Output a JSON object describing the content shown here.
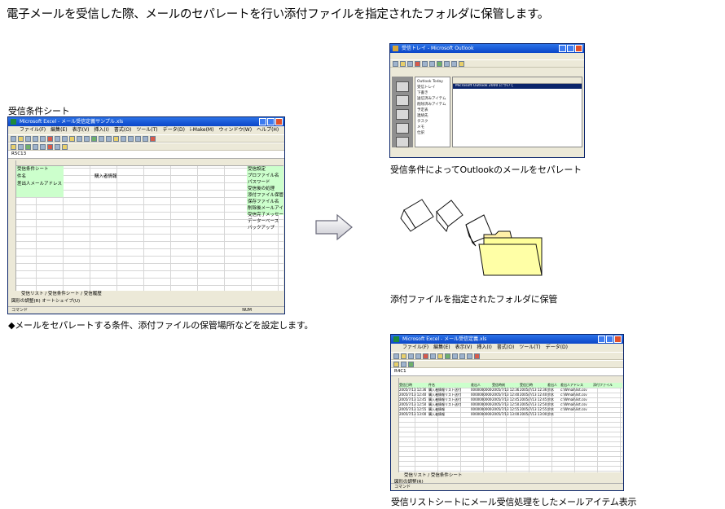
{
  "headline": "電子メールを受信した際、メールのセパレートを行い添付ファイルを指定されたフォルダに保管します。",
  "left_panel": {
    "label": "受信条件シート",
    "window_title": "Microsoft Excel - メール受信定義サンプル.xls",
    "menu": [
      "ファイル(F)",
      "編集(E)",
      "表示(V)",
      "挿入(I)",
      "書式(O)",
      "ツール(T)",
      "データ(D)",
      "i-Make(M)",
      "ウィンドウ(W)",
      "ヘルプ(H)"
    ],
    "name_box": "R5C13",
    "sheet_tabs": [
      "受信リスト",
      "受信条件シート",
      "受信履歴"
    ],
    "status": "コマンド",
    "status_right": "NUM",
    "drawing_toolbar": "図形の調整(R)",
    "autoshape": "オートシェイプ(U)",
    "cells": {
      "header": "受信条件シート",
      "r1": "件名",
      "r2": "差出人メールアドレス",
      "mid": "購入者情報",
      "side": [
        "受信設定",
        "プロファイル名",
        "パスワード",
        "受信後の処理",
        "添付ファイル保管先",
        "保存ファイル名",
        "削除後メールアイテム",
        "受信完了メッセージ",
        "データーベース",
        "バックアップ"
      ]
    },
    "caption": "◆メールをセパレートする条件、添付ファイルの保管場所などを設定します。"
  },
  "outlook_panel": {
    "window_title": "受信トレイ - Microsoft Outlook",
    "tree": [
      "Outlook Today",
      "受信トレイ",
      "下書き",
      "送信済みアイテム",
      "削除済みアイテム",
      "予定表",
      "連絡先",
      "タスク",
      "メモ",
      "仕訳"
    ],
    "selected_row": "Microsoft Outlook 2000 について",
    "caption": "受信条件によってOutlookのメールをセパレート"
  },
  "folder_panel": {
    "caption": "添付ファイルを指定されたフォルダに保管"
  },
  "list_panel": {
    "window_title": "Microsoft Excel - メール受信定義.xls",
    "name_box": "R4C1",
    "columns": [
      "受信日時",
      "件名",
      "差出人",
      "受信時刻",
      "受信日時",
      "差出人",
      "差出人アドレス",
      "添付ファイル"
    ],
    "rows": [
      [
        "2005/7/13 12:36",
        "購入者情報リスト送付",
        "00000000000",
        "2005/7/13 12:36",
        "2005/7/13 12:36",
        "鈴木",
        "c:\\Wmail\\list.csv"
      ],
      [
        "2005/7/13 12:40",
        "購入者情報リスト送付",
        "00000000000",
        "2005/7/13 12:40",
        "2005/7/13 12:40",
        "鈴木",
        "c:\\Wmail\\list.csv"
      ],
      [
        "2005/7/13 12:45",
        "購入者情報リスト送付",
        "00000000000",
        "2005/7/13 12:45",
        "2005/7/13 12:45",
        "鈴木",
        "c:\\Wmail\\list.csv"
      ],
      [
        "2005/7/13 12:50",
        "購入者情報リスト送付",
        "00000000000",
        "2005/7/13 12:50",
        "2005/7/13 12:50",
        "鈴木",
        "c:\\Wmail\\list.csv"
      ],
      [
        "2005/7/13 12:55",
        "購入者情報",
        "00000000000",
        "2005/7/13 12:55",
        "2005/7/13 12:55",
        "鈴木",
        "c:\\Wmail\\list.csv"
      ],
      [
        "2005/7/13 13:00",
        "購入者情報",
        "00000000000",
        "2005/7/13 13:00",
        "2005/7/13 13:00",
        "鈴木",
        ""
      ]
    ],
    "sheet_tabs": [
      "受信リスト",
      "受信条件シート"
    ],
    "status": "コマンド",
    "caption": "受信リストシートにメール受信処理をしたメールアイテム表示"
  }
}
